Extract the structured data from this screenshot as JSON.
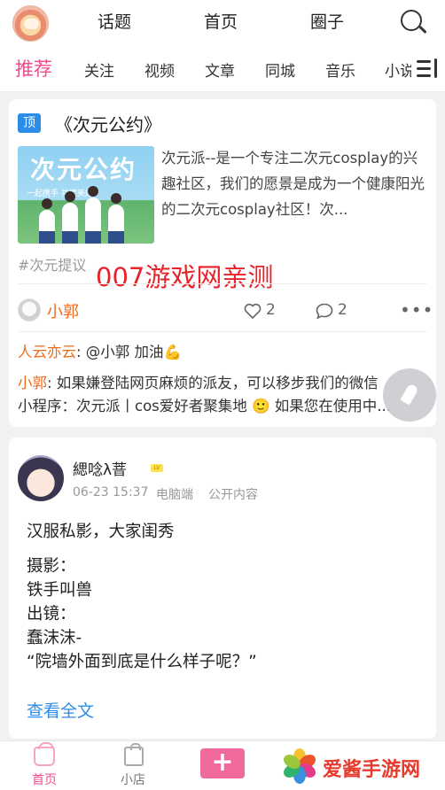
{
  "header": {
    "nav": [
      "话题",
      "首页",
      "圈子"
    ]
  },
  "tabs": {
    "items": [
      "推荐",
      "关注",
      "视频",
      "文章",
      "同城",
      "音乐",
      "小说"
    ]
  },
  "post1": {
    "topic_badge": "顶",
    "topic_title": "《次元公约》",
    "banner_title": "次元公约",
    "banner_subtitle": "一起携手 共建美好",
    "description": "次元派--是一个专注二次元cosplay的兴趣社区，我们的愿景是成为一个健康阳光的二次元cosplay社区！次...",
    "hashtag": "#次元提议",
    "overlay_text": "007游戏网亲测",
    "author": "小郭",
    "likes": "2",
    "comments_count": "2",
    "comments": [
      {
        "name": "人云亦云",
        "sep": ":",
        "text": " @小郭 加油💪"
      },
      {
        "name": "小郭",
        "sep": ":",
        "text": " 如果嫌登陆网页麻烦的派友，可以移步我们的微信"
      },
      {
        "name": "",
        "sep": "",
        "text": "小程序：次元派丨cos爱好者聚集地 🙂 如果您在使用中..."
      }
    ]
  },
  "post2": {
    "username": "緦唸λ萻",
    "level": "LV",
    "date": "06-23 15:37",
    "device": "电脑端",
    "visibility": "公开内容",
    "lines": [
      "汉服私影，大家闺秀",
      "摄影：",
      "铁手叫兽",
      "出镜：",
      "蠢沫沫-",
      "“院墙外面到底是什么样子呢？”"
    ],
    "read_more": "查看全文"
  },
  "bottom_nav": {
    "home": "首页",
    "shop": "小店",
    "plus": "+"
  },
  "watermark": {
    "logo_text": "爱酱手游网"
  }
}
